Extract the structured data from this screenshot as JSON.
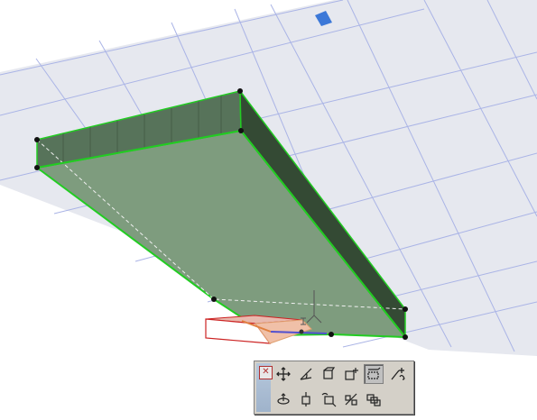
{
  "viewport": {
    "background_color": "#ffffff",
    "plane_color": "#e6e8ef",
    "grid_color": "#aab4e6",
    "slab_top_color": "#7e9c7e",
    "slab_side_color": "#3f5a3f",
    "selection_color": "#22cc22",
    "marker_color": "#3c78d8"
  },
  "palette": {
    "close_glyph": "✕",
    "row1": [
      "move-icon",
      "rotate-icon",
      "mirror-icon",
      "add-to-polygon-icon",
      "subtract-from-polygon-icon",
      "offset-edge-icon",
      "magic-wand-icon"
    ],
    "row2": [
      "elevate-icon",
      "rotate-3d-icon",
      "drag-copy-icon",
      "mirror-copy-icon",
      "multiply-icon"
    ],
    "active_index": 5
  }
}
